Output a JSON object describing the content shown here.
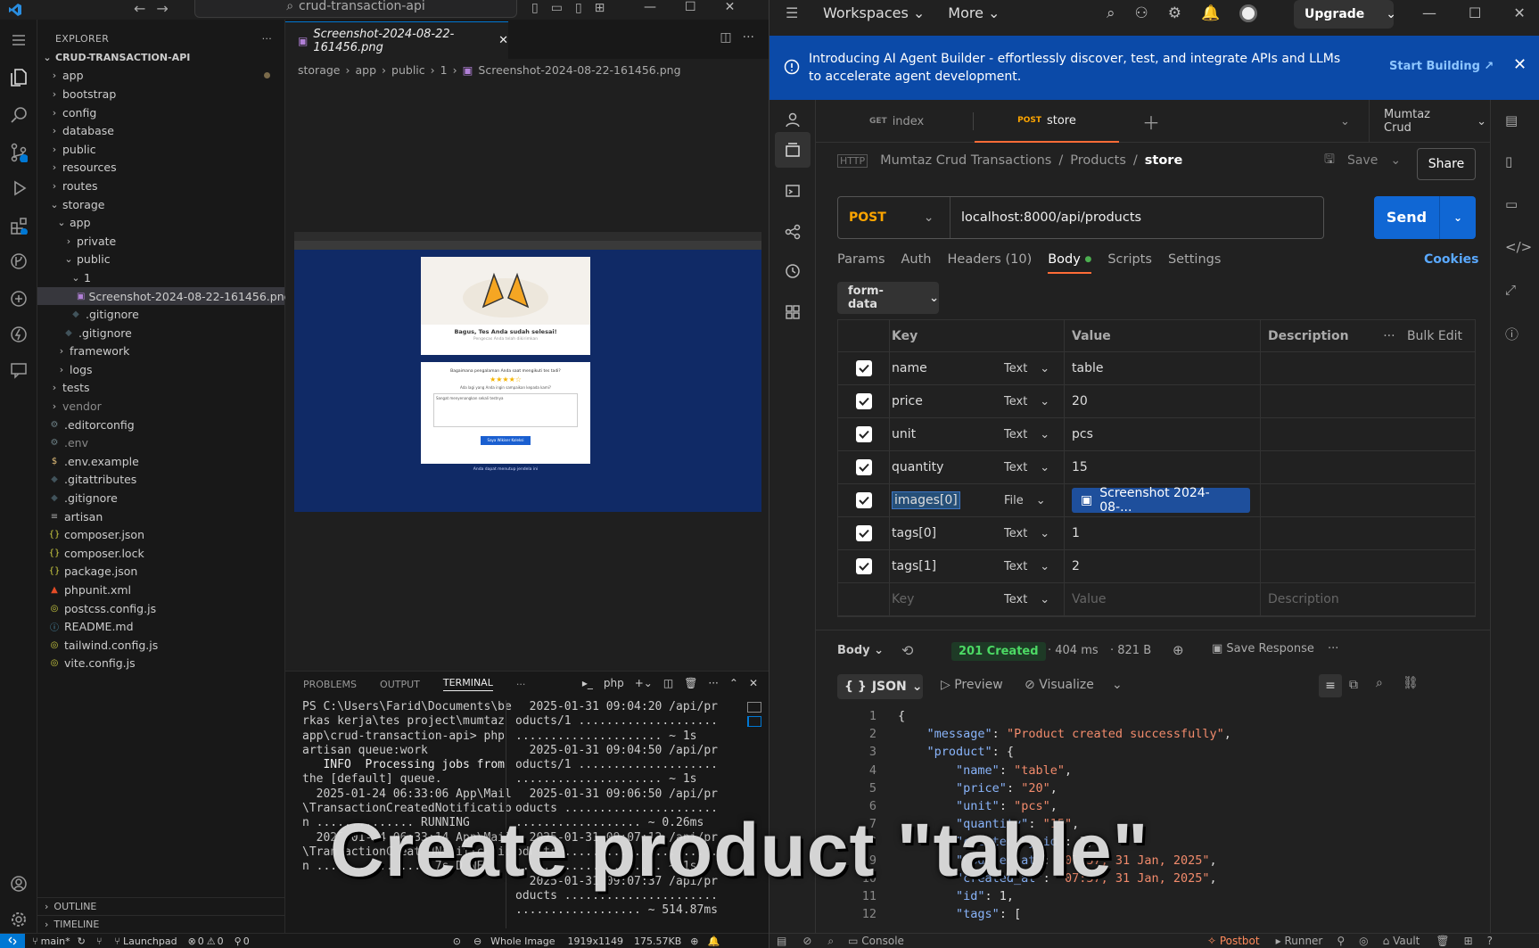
{
  "vscode": {
    "command_center": "crud-transaction-api",
    "explorer_title": "EXPLORER",
    "project_name": "CRUD-TRANSACTION-API",
    "tree": [
      {
        "label": "app",
        "kind": "folder",
        "depth": 0,
        "open": false,
        "modified": true
      },
      {
        "label": "bootstrap",
        "kind": "folder",
        "depth": 0,
        "open": false
      },
      {
        "label": "config",
        "kind": "folder",
        "depth": 0,
        "open": false
      },
      {
        "label": "database",
        "kind": "folder",
        "depth": 0,
        "open": false
      },
      {
        "label": "public",
        "kind": "folder",
        "depth": 0,
        "open": false
      },
      {
        "label": "resources",
        "kind": "folder",
        "depth": 0,
        "open": false
      },
      {
        "label": "routes",
        "kind": "folder",
        "depth": 0,
        "open": false
      },
      {
        "label": "storage",
        "kind": "folder",
        "depth": 0,
        "open": true
      },
      {
        "label": "app",
        "kind": "folder",
        "depth": 1,
        "open": true
      },
      {
        "label": "private",
        "kind": "folder",
        "depth": 2,
        "open": false
      },
      {
        "label": "public",
        "kind": "folder",
        "depth": 2,
        "open": true
      },
      {
        "label": "1",
        "kind": "folder",
        "depth": 3,
        "open": true
      },
      {
        "label": "Screenshot-2024-08-22-161456.png",
        "kind": "image",
        "depth": 4,
        "selected": true
      },
      {
        "label": ".gitignore",
        "kind": "gitignore",
        "depth": 3
      },
      {
        "label": ".gitignore",
        "kind": "gitignore",
        "depth": 2
      },
      {
        "label": "framework",
        "kind": "folder",
        "depth": 1,
        "open": false
      },
      {
        "label": "logs",
        "kind": "folder",
        "depth": 1,
        "open": false
      },
      {
        "label": "tests",
        "kind": "folder",
        "depth": 0,
        "open": false
      },
      {
        "label": "vendor",
        "kind": "folder",
        "depth": 0,
        "open": false,
        "dim": true
      },
      {
        "label": ".editorconfig",
        "kind": "gear",
        "depth": 0
      },
      {
        "label": ".env",
        "kind": "gear",
        "depth": 0,
        "dim": true
      },
      {
        "label": ".env.example",
        "kind": "dollar",
        "depth": 0
      },
      {
        "label": ".gitattributes",
        "kind": "gitignore",
        "depth": 0
      },
      {
        "label": ".gitignore",
        "kind": "gitignore",
        "depth": 0
      },
      {
        "label": "artisan",
        "kind": "lines",
        "depth": 0
      },
      {
        "label": "composer.json",
        "kind": "braces",
        "depth": 0
      },
      {
        "label": "composer.lock",
        "kind": "braces",
        "depth": 0
      },
      {
        "label": "package.json",
        "kind": "braces",
        "depth": 0
      },
      {
        "label": "phpunit.xml",
        "kind": "xml",
        "depth": 0
      },
      {
        "label": "postcss.config.js",
        "kind": "js",
        "depth": 0
      },
      {
        "label": "README.md",
        "kind": "info",
        "depth": 0
      },
      {
        "label": "tailwind.config.js",
        "kind": "js",
        "depth": 0
      },
      {
        "label": "vite.config.js",
        "kind": "js",
        "depth": 0
      }
    ],
    "outline_label": "OUTLINE",
    "timeline_label": "TIMELINE",
    "tab_title": "Screenshot-2024-08-22-161456.png",
    "breadcrumb": [
      "storage",
      "app",
      "public",
      "1",
      "Screenshot-2024-08-22-161456.png"
    ],
    "panel_tabs": [
      "PROBLEMS",
      "OUTPUT",
      "TERMINAL"
    ],
    "terminal_shell": "php",
    "terminal_left": [
      "PS C:\\Users\\Farid\\Documents\\be",
      "rkas kerja\\tes project\\mumtaz",
      "app\\crud-transaction-api> php",
      "artisan queue:work",
      "",
      "   INFO  Processing jobs from",
      "the [default] queue.",
      "",
      "  2025-01-24 06:33:06 App\\Mail",
      "\\TransactionCreatedNotificatio",
      "n .............. RUNNING",
      "  2025-01-24 06:33:14 App\\Mail",
      "\\TransactionCreatedNotificatio",
      "n ................ 7s DONE"
    ],
    "terminal_right": [
      "  2025-01-31 09:04:20 /api/pr",
      "oducts/1 ....................",
      "..................... ~ 1s",
      "  2025-01-31 09:04:50 /api/pr",
      "oducts/1 ....................",
      "..................... ~ 1s",
      "  2025-01-31 09:06:50 /api/pr",
      "oducts ......................",
      ".................. ~ 0.26ms",
      "  2025-01-31 09:07:12 /api/pr",
      "oducts ......................",
      "..................... ~ 1s",
      "  2025-01-31 09:07:37 /api/pr",
      "oducts ......................",
      ".................. ~ 514.87ms"
    ],
    "status": {
      "branch": "main*",
      "launchpad": "Launchpad",
      "errors": "0",
      "warnings": "0",
      "ports": "0",
      "image_mode": "Whole Image",
      "dimensions": "1919x1149",
      "filesize": "175.57KB"
    },
    "preview": {
      "title": "Bagus, Tes Anda sudah selesai!",
      "subtitle": "Pengecas Anda telah dikirimkan",
      "question": "Bagaimana pengalaman Anda saat mengikuti tes tadi?",
      "prompt": "Ada lagi yang Anda ingin sampaikan kepada kami?",
      "placeholder": "Sangat menyenangkan sekali testnya",
      "button": "Saya Wikiser Koleksi",
      "footer": "Anda dapat menutup jendela ini"
    }
  },
  "postman": {
    "nav": [
      "Workspaces",
      "More"
    ],
    "upgrade": "Upgrade",
    "banner": {
      "text": "Introducing AI Agent Builder - effortlessly discover, test, and integrate APIs and LLMs to accelerate agent development.",
      "cta": "Start Building ↗"
    },
    "tabs": [
      {
        "method": "GET",
        "name": "index",
        "active": false
      },
      {
        "method": "POST",
        "name": "store",
        "active": true
      }
    ],
    "environment": "Mumtaz Crud",
    "breadcrumb": [
      "Mumtaz Crud Transactions",
      "Products",
      "store"
    ],
    "save": "Save",
    "share": "Share",
    "method": "POST",
    "url": "localhost:8000/api/products",
    "send": "Send",
    "subtabs": [
      "Params",
      "Auth",
      "Headers (10)",
      "Body",
      "Scripts",
      "Settings"
    ],
    "cookies": "Cookies",
    "body_type": "form-data",
    "table_headers": {
      "key": "Key",
      "value": "Value",
      "description": "Description",
      "bulk": "Bulk Edit"
    },
    "rows": [
      {
        "key": "name",
        "type": "Text",
        "value": "table"
      },
      {
        "key": "price",
        "type": "Text",
        "value": "20"
      },
      {
        "key": "unit",
        "type": "Text",
        "value": "pcs"
      },
      {
        "key": "quantity",
        "type": "Text",
        "value": "15"
      },
      {
        "key": "images[0]",
        "type": "File",
        "value": "Screenshot 2024-08-..."
      },
      {
        "key": "tags[0]",
        "type": "Text",
        "value": "1"
      },
      {
        "key": "tags[1]",
        "type": "Text",
        "value": "2"
      }
    ],
    "placeholder_row": {
      "key": "Key",
      "type": "Text",
      "value": "Value",
      "description": "Description"
    },
    "response": {
      "label": "Body",
      "status": "201 Created",
      "time": "404 ms",
      "size": "821 B",
      "save": "Save Response",
      "format": "JSON",
      "preview": "Preview",
      "visualize": "Visualize"
    },
    "code_lines": [
      "{",
      "    \"message\": \"Product created successfully\",",
      "    \"product\": {",
      "        \"name\": \"table\",",
      "        \"price\": \"20\",",
      "        \"unit\": \"pcs\",",
      "        \"quantity\": \"15\",",
      "        \"created_by_id\": 1,",
      "        \"updated_at\": \"07:37, 31 Jan, 2025\",",
      "        \"created_at\": \"07:37, 31 Jan, 2025\",",
      "        \"id\": 1,",
      "        \"tags\": ["
    ],
    "statusbar": [
      "Console",
      "Postbot",
      "Runner",
      "Vault"
    ]
  },
  "caption": "Create product \"table\""
}
